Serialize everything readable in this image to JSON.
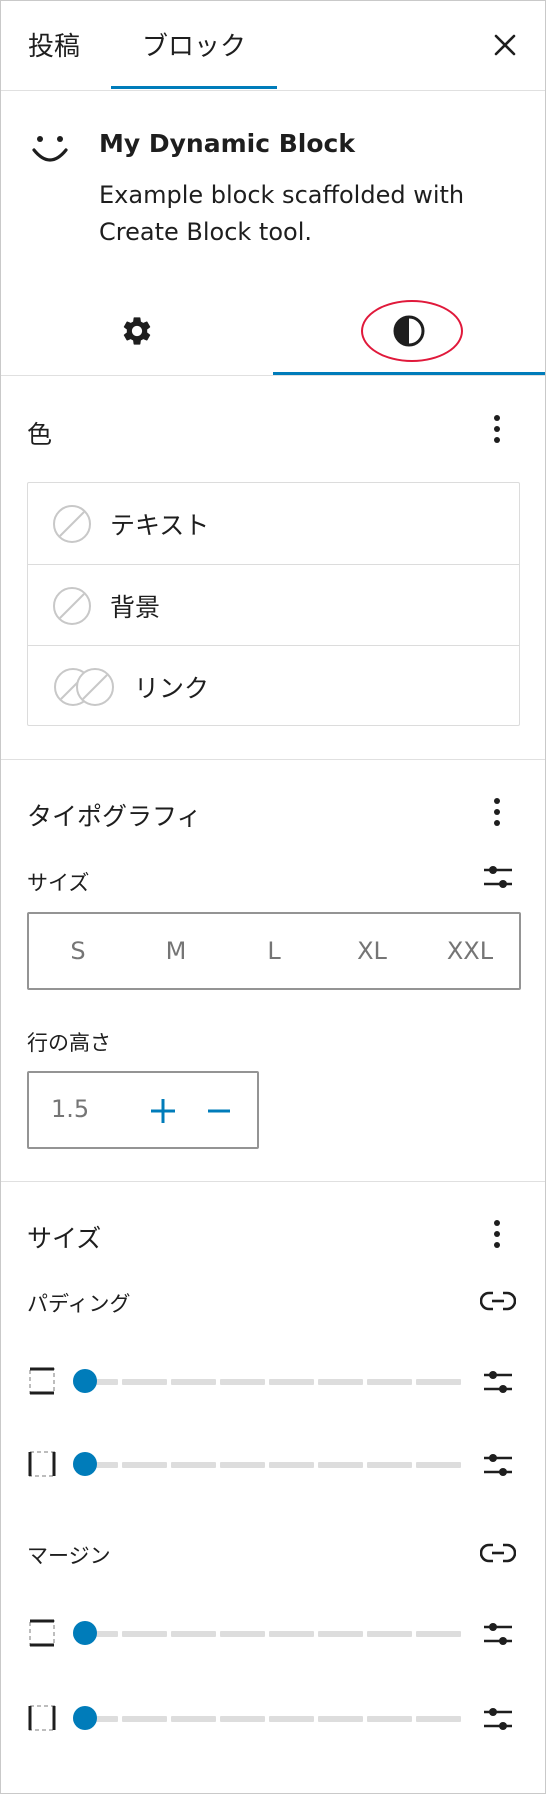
{
  "tabs": {
    "post": "投稿",
    "block": "ブロック"
  },
  "block": {
    "title": "My Dynamic Block",
    "description": "Example block scaffolded with Create Block tool."
  },
  "color": {
    "title": "色",
    "items": [
      {
        "label": "テキスト"
      },
      {
        "label": "背景"
      },
      {
        "label": "リンク"
      }
    ]
  },
  "typography": {
    "title": "タイポグラフィ",
    "size_label": "サイズ",
    "sizes": [
      "S",
      "M",
      "L",
      "XL",
      "XXL"
    ],
    "line_height_label": "行の高さ",
    "line_height_value": "1.5"
  },
  "dimensions": {
    "title": "サイズ",
    "padding_label": "パディング",
    "margin_label": "マージン",
    "padding_vertical": 0,
    "padding_horizontal": 0,
    "margin_vertical": 0,
    "margin_horizontal": 0
  },
  "colors": {
    "accent": "#007cba",
    "highlight": "#e0193b"
  }
}
